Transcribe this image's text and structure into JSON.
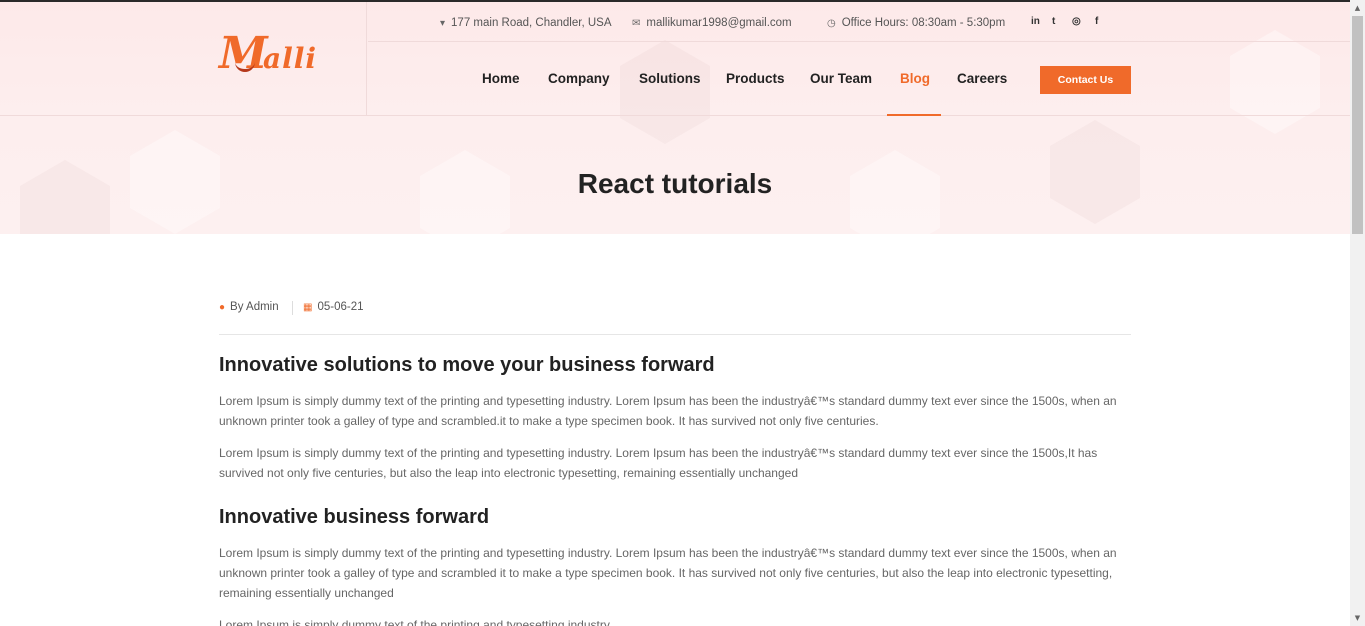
{
  "header": {
    "logo_text": "Malli",
    "address": "177 main Road, Chandler, USA",
    "email": "mallikumar1998@gmail.com",
    "office_hours": "Office Hours: 08:30am - 5:30pm",
    "social": {
      "linkedin": "in",
      "twitter": "t",
      "instagram": "◎",
      "facebook": "f"
    }
  },
  "nav": {
    "items": [
      "Home",
      "Company",
      "Solutions",
      "Products",
      "Our Team",
      "Blog",
      "Careers"
    ],
    "active": "Blog",
    "contact_label": "Contact Us"
  },
  "page": {
    "title": "React tutorials",
    "author": "By Admin",
    "date": "05-06-21"
  },
  "article": {
    "heading1": "Innovative solutions to move your business forward",
    "para1": "Lorem Ipsum is simply dummy text of the printing and typesetting industry. Lorem Ipsum has been the industryâ€™s standard dummy text ever since the 1500s, when an unknown printer took a galley of type and scrambled.it to make a type specimen book. It has survived not only five centuries.",
    "para2": "Lorem Ipsum is simply dummy text of the printing and typesetting industry. Lorem Ipsum has been the industryâ€™s standard dummy text ever since the 1500s,It has survived not only five centuries, but also the leap into electronic typesetting, remaining essentially unchanged",
    "heading2": "Innovative business forward",
    "para3": "Lorem Ipsum is simply dummy text of the printing and typesetting industry. Lorem Ipsum has been the industryâ€™s standard dummy text ever since the 1500s, when an unknown printer took a galley of type and scrambled it to make a type specimen book. It has survived not only five centuries, but also the leap into electronic typesetting, remaining essentially unchanged",
    "para4": "Lorem Ipsum is simply dummy text of the printing and typesetting industry."
  },
  "colors": {
    "accent": "#f06a2a",
    "hero_bg": "#fdeeee",
    "text": "#222222",
    "muted": "#666666"
  },
  "icons": {
    "location": "map-pin-icon",
    "email": "envelope-icon",
    "clock": "clock-icon",
    "user": "user-icon",
    "calendar": "calendar-icon"
  }
}
